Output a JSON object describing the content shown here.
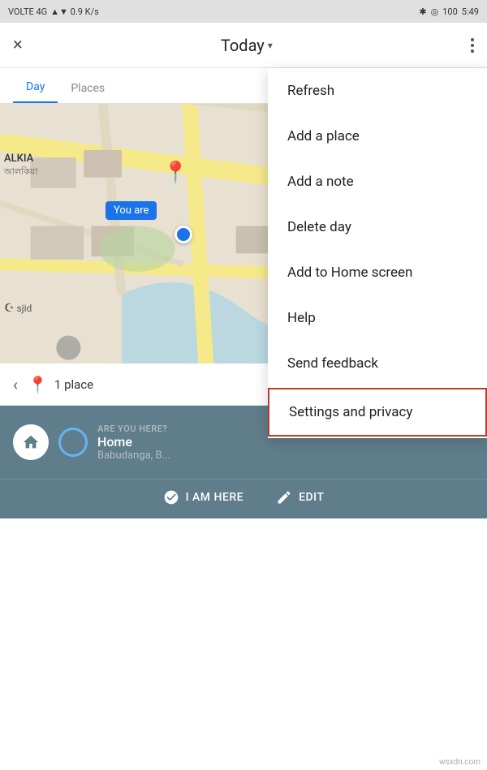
{
  "statusBar": {
    "left": "VOLTE 4G",
    "signal": "▲▼ 0.9 K/s",
    "right": "5:49",
    "battery": "100"
  },
  "topBar": {
    "closeLabel": "×",
    "title": "Today",
    "dropdownArrow": "▾",
    "moreLabel": "⋮"
  },
  "tabs": [
    {
      "label": "Day",
      "active": true
    },
    {
      "label": "Places",
      "active": false
    }
  ],
  "map": {
    "youAreLabel": "You are",
    "alkiaLabel": "ALKIA",
    "alkiaSub": "আলকিয়া",
    "mosqueName": "sjid"
  },
  "mapNav": {
    "arrowLabel": "‹",
    "pinIcon": "📍",
    "placeCount": "1 place"
  },
  "locationCard": {
    "areYouHere": "ARE YOU HERE?",
    "homeName": "Home",
    "address": "Babudanga, B..."
  },
  "actionBar": {
    "iAmHereLabel": "I AM HERE",
    "editLabel": "EDIT"
  },
  "dropdownMenu": {
    "items": [
      {
        "label": "Refresh",
        "highlighted": false
      },
      {
        "label": "Add a place",
        "highlighted": false
      },
      {
        "label": "Add a note",
        "highlighted": false
      },
      {
        "label": "Delete day",
        "highlighted": false
      },
      {
        "label": "Add to Home screen",
        "highlighted": false
      },
      {
        "label": "Help",
        "highlighted": false
      },
      {
        "label": "Send feedback",
        "highlighted": false
      },
      {
        "label": "Settings and privacy",
        "highlighted": true
      }
    ]
  },
  "watermark": "wsxdn.com"
}
